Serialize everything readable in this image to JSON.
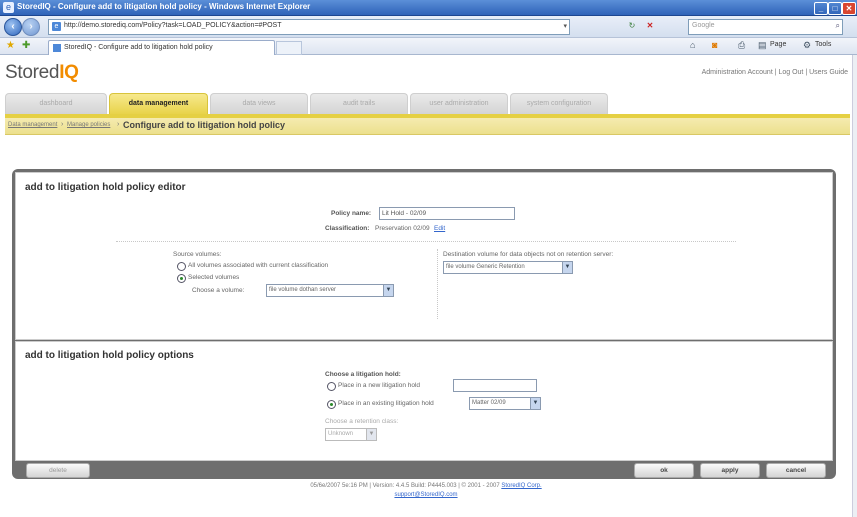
{
  "window": {
    "title": "StoredIQ - Configure add to litigation hold policy - Windows Internet Explorer",
    "minimize": "_",
    "maximize": "□",
    "close": "✕"
  },
  "navbar": {
    "back_icon": "back-arrow-icon",
    "forward_icon": "forward-arrow-icon",
    "address": "http://demo.storediq.com/Policy?task=LOAD_POLICY&action=#POST",
    "search_placeholder": "Google"
  },
  "tabbar": {
    "tab_title": "StoredIQ - Configure add to litigation hold policy",
    "page_label": "Page",
    "tools_label": "Tools"
  },
  "app": {
    "logo_text": "Stored",
    "logo_accent": "IQ",
    "top_links": "Administration Account | Log Out | Users Guide",
    "tabs": [
      {
        "label": "dashboard",
        "active": false
      },
      {
        "label": "data management",
        "active": true
      },
      {
        "label": "data views",
        "active": false
      },
      {
        "label": "audit trails",
        "active": false
      },
      {
        "label": "user administration",
        "active": false
      },
      {
        "label": "system configuration",
        "active": false
      }
    ],
    "breadcrumb": {
      "crumb1": "Data management",
      "crumb2": "Manage policies",
      "current": "Configure add to litigation hold policy"
    }
  },
  "editor": {
    "title": "add to litigation hold policy editor",
    "policy_name_label": "Policy name:",
    "policy_name_value": "Lit Hold - 02/09",
    "classification_label": "Classification:",
    "classification_value": "Preservation 02/09",
    "classification_edit": "Edit",
    "source_volumes_label": "Source volumes:",
    "radio_all": "All volumes associated with current classification",
    "radio_selected": "Selected volumes",
    "choose_volume_label": "Choose a volume:",
    "choose_volume_value": "file volume dothan server",
    "destination_label": "Destination volume for data objects not on retention server:",
    "destination_value": "file volume Generic Retention"
  },
  "options": {
    "title": "add to litigation hold policy options",
    "choose_hold_label": "Choose a litigation hold:",
    "radio_new": "Place in a new litigation hold",
    "new_value": "",
    "radio_existing": "Place in an existing litigation hold",
    "existing_value": "Matter 02/09",
    "retention_label": "Choose a retention class:",
    "retention_value": "Unknown"
  },
  "buttons": {
    "delete": "delete",
    "ok": "ok",
    "apply": "apply",
    "cancel": "cancel"
  },
  "footer": {
    "line1_text": "05/6e/2007 5e:16 PM | Version: 4.4.5 Build: P4445.003 | © 2001 - 2007 ",
    "line1_link": "StoredIQ Corp.",
    "line2_link": "support@StoredIQ.com"
  },
  "colors": {
    "accent_yellow": "#e5d043",
    "titlebar_blue": "#2f63b8",
    "logo_orange": "#f28c00",
    "frame_gray": "#6e6e6e"
  }
}
